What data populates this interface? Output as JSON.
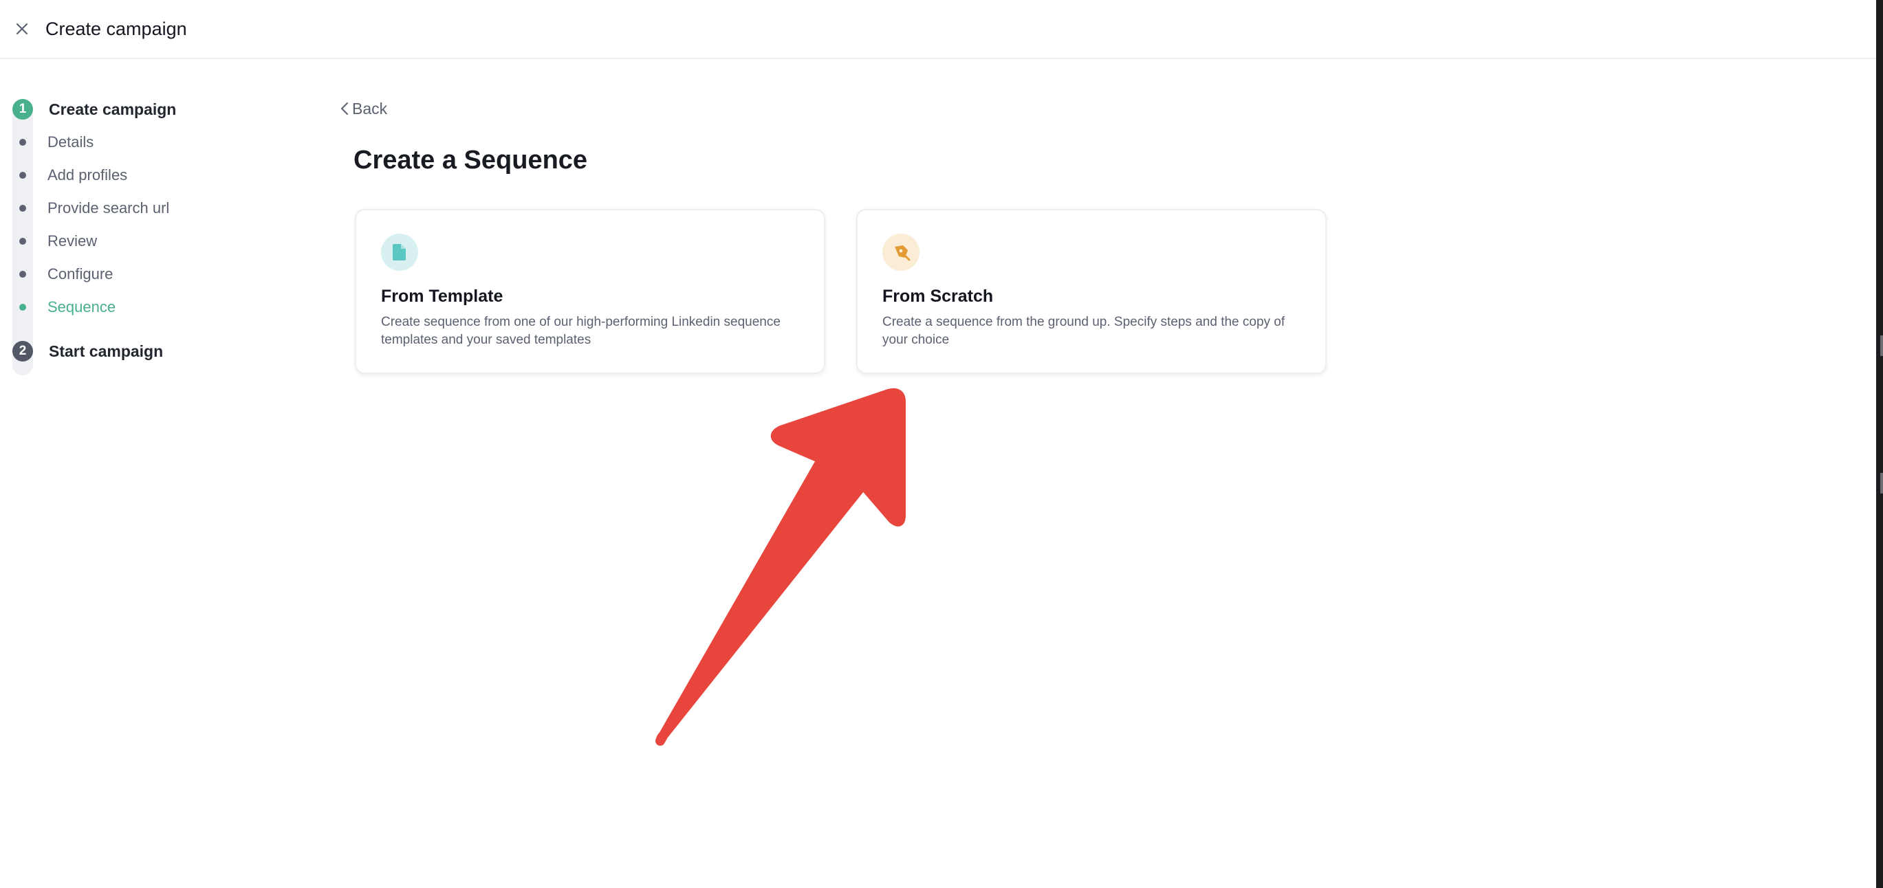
{
  "header": {
    "title": "Create campaign",
    "close_icon": "close-icon"
  },
  "stepper": {
    "steps": [
      {
        "number": "1",
        "label": "Create campaign",
        "state": "active",
        "substeps": [
          {
            "label": "Details",
            "current": false
          },
          {
            "label": "Add profiles",
            "current": false
          },
          {
            "label": "Provide search url",
            "current": false
          },
          {
            "label": "Review",
            "current": false
          },
          {
            "label": "Configure",
            "current": false
          },
          {
            "label": "Sequence",
            "current": true
          }
        ]
      },
      {
        "number": "2",
        "label": "Start campaign",
        "state": "inactive",
        "substeps": []
      }
    ]
  },
  "main": {
    "back_label": "Back",
    "title": "Create a Sequence",
    "cards": [
      {
        "icon": "document-icon",
        "title": "From Template",
        "description": "Create sequence from one of our high-performing Linkedin sequence templates and your saved templates"
      },
      {
        "icon": "pen-tool-icon",
        "title": "From Scratch",
        "description": "Create a sequence from the ground up. Specify steps and the copy of your choice"
      }
    ]
  },
  "colors": {
    "accent": "#48b08b",
    "muted": "#5b6170",
    "arrow": "#e8453c",
    "template_icon_bg": "#d8f1f0",
    "template_icon_fg": "#5cc6c2",
    "scratch_icon_bg": "#fbecd6",
    "scratch_icon_fg": "#e39a34"
  }
}
